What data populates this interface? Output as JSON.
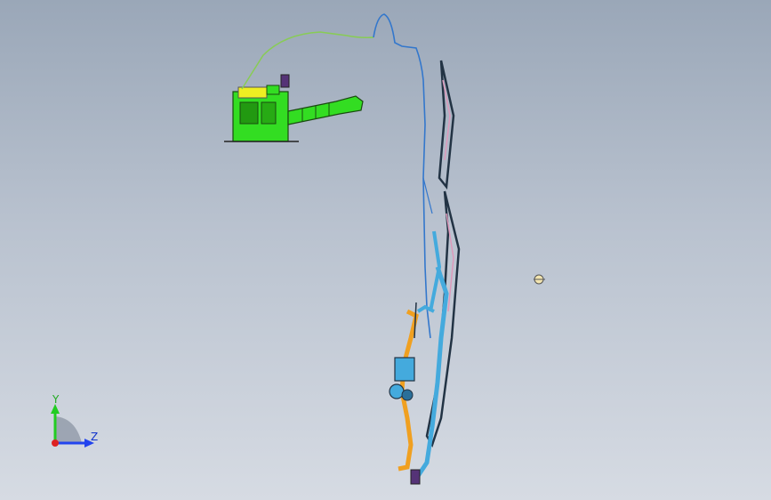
{
  "triad": {
    "y_label": "Y",
    "z_label": "Z",
    "colors": {
      "y": "#22cc22",
      "z": "#2244ee",
      "x": "#dd2222"
    }
  },
  "model": {
    "colors": {
      "air_box": "#33dd22",
      "air_box_accent": "#eeee22",
      "harness": "#3377cc",
      "harness_green": "#88cc55",
      "radiator": "#223344",
      "radiator_pink": "#dd99bb",
      "pipe_blue": "#44aadd",
      "pipe_orange": "#f0a020",
      "small_part": "#f3e5b0"
    }
  }
}
